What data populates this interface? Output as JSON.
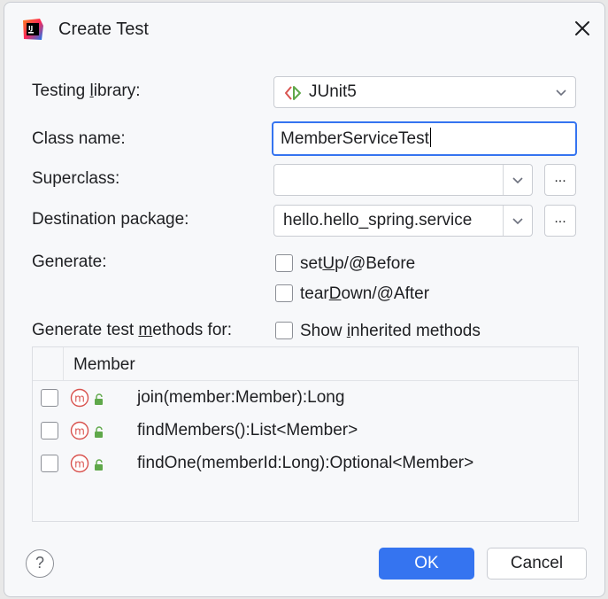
{
  "dialog": {
    "title": "Create Test",
    "icon": "intellij-idea-icon"
  },
  "form": {
    "testing_library": {
      "label_pre": "Testing ",
      "label_u": "l",
      "label_post": "ibrary:",
      "value": "JUnit5",
      "icon": "junit-icon"
    },
    "class_name": {
      "label": "Class name:",
      "value": "MemberServiceTest"
    },
    "superclass": {
      "label": "Superclass:",
      "value": "",
      "browse": "..."
    },
    "destination_package": {
      "label": "Destination package:",
      "value": "hello.hello_spring.service",
      "browse": "..."
    },
    "generate": {
      "label": "Generate:",
      "options": [
        {
          "pre": "set",
          "u": "U",
          "post": "p/@Before",
          "checked": false
        },
        {
          "pre": "tear",
          "u": "D",
          "post": "own/@After",
          "checked": false
        }
      ]
    },
    "methods_for": {
      "label_pre": "Generate test ",
      "label_u": "m",
      "label_post": "ethods for:",
      "show_inherited": {
        "pre": "Show ",
        "u": "i",
        "post": "nherited methods",
        "checked": false
      }
    }
  },
  "table": {
    "header": "Member",
    "rows": [
      {
        "signature": "join(member:Member):Long",
        "checked": false
      },
      {
        "signature": "findMembers():List<Member>",
        "checked": false
      },
      {
        "signature": "findOne(memberId:Long):Optional<Member>",
        "checked": false
      }
    ]
  },
  "buttons": {
    "help": "?",
    "ok": "OK",
    "cancel": "Cancel"
  },
  "colors": {
    "accent": "#3574f0",
    "method_icon": "#d9534f",
    "lock_icon": "#5fa84a"
  }
}
